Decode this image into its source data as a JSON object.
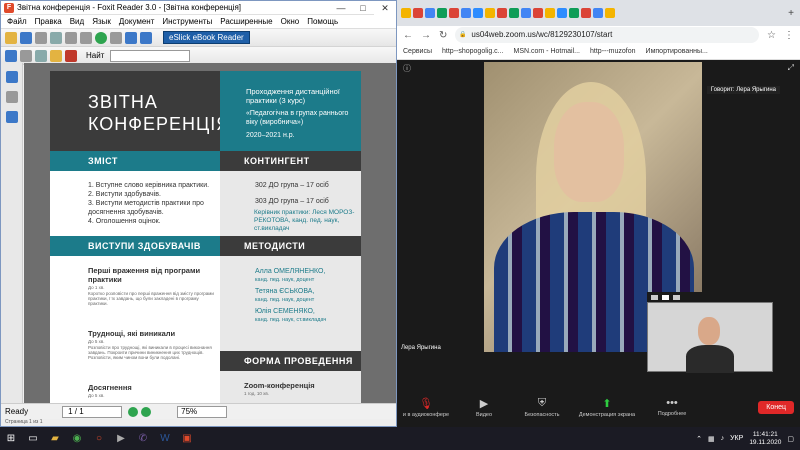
{
  "foxit": {
    "title": "Звітна конференція - Foxit Reader 3.0 - [Звітна конференція]",
    "menu": [
      "Файл",
      "Правка",
      "Вид",
      "Язык",
      "Документ",
      "Инструменты",
      "Расширенные",
      "Окно",
      "Помощь"
    ],
    "ebook": "eSlick eBook Reader",
    "find_label": "Найт",
    "status": "Ready",
    "page_field": "1 / 1",
    "zoom_field": "75%",
    "status2": "Страница 1 из 1",
    "doc": {
      "title1": "ЗВІТНА",
      "title2": "КОНФЕРЕНЦІЯ",
      "right_title": "Проходження дистанційної практики (3 курс)",
      "right_sub": "«Педагогічна в групах раннього віку (виробнича»)",
      "right_year": "2020–2021 н.р.",
      "sec_contents": "ЗМІСТ",
      "sec_contingent": "КОНТИНГЕНТ",
      "contents": [
        "1. Вступне слово керівника практики.",
        "2. Виступи здобувачів.",
        "3. Виступи методистів практики про досягнення здобувачів.",
        "4. Оголошення оцінок."
      ],
      "group1": "302 ДО група – 17 осіб",
      "group2": "303 ДО група – 17 осіб",
      "supervisors": "Керівник практики: Леся МОРОЗ-РЕКОТОВА, канд. пед. наук, ст.викладач",
      "sec_speeches": "ВИСТУПИ ЗДОБУВАЧІВ",
      "sec_methodists": "МЕТОДИСТИ",
      "s1_title": "Перші враження від програми практики",
      "s1_time": "До 1 хв.",
      "s1_text": "Коротко розповісти про перші враження від змісту програми практики, ї їх завдань, що були закладені в програму практики.",
      "s2_title": "Труднощі, які виникали",
      "s2_time": "До 5 хв.",
      "s2_text": "Розповісти про труднощі, які виникали в процесі виконання завдань. Покроити причини виникнення цих труднощів. Розповісти, яким чином вони були подолані.",
      "s3_title": "Досягнення",
      "s3_time": "До 5 хв.",
      "m1": "Алла ОМЕЛЯНЕНКО,",
      "m1d": "канд. пед. наук, доцент",
      "m2": "Тетяна ЄСЬКОВА,",
      "m2d": "канд. пед. наук, доцент",
      "m3": "Юлія СЕМЕНЯКО,",
      "m3d": "канд. пед. наук, ст.викладач",
      "sec_form": "ФОРМА ПРОВЕДЕННЯ",
      "form": "Zoom-конференція",
      "form_time": "1 год. 10 хв."
    }
  },
  "chrome": {
    "url": "us04web.zoom.us/wc/8129230107/start",
    "bookmarks": [
      "Сервисы",
      "http--shopogolig.c...",
      "MSN.com - Hotmail...",
      "http---muzofon",
      "Импортированны..."
    ]
  },
  "zoom": {
    "speaking": "Говорит: Лера Ярыгина",
    "name": "Лера Ярыгина",
    "tools": [
      "и в аудиоконфере",
      "Видео",
      "Безопасность",
      "Демонстрация экрана",
      "Подробнее"
    ],
    "end": "Конец"
  },
  "taskbar": {
    "lang": "УКР",
    "time": "11:41:21",
    "date": "19.11.2020"
  }
}
